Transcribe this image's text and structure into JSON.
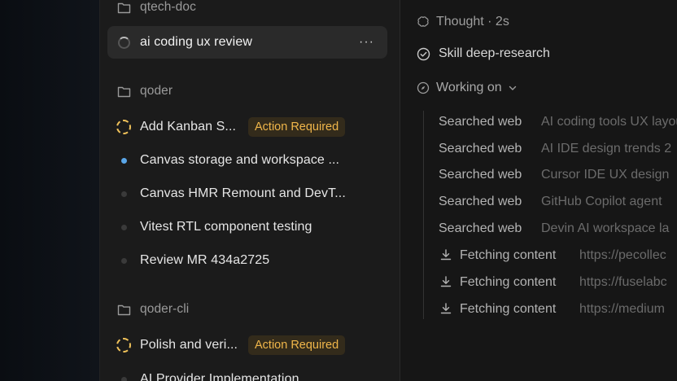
{
  "sidebar": {
    "groups": [
      {
        "name": "qtech-doc"
      },
      {
        "name": "qoder"
      },
      {
        "name": "qoder-cli"
      }
    ],
    "selected": {
      "label": "ai coding ux review",
      "more": "···"
    },
    "items": [
      {
        "label": "Add Kanban S...",
        "badge": "Action Required"
      },
      {
        "label": "Canvas storage and workspace ..."
      },
      {
        "label": "Canvas HMR Remount and DevT..."
      },
      {
        "label": "Vitest RTL component testing"
      },
      {
        "label": "Review MR 434a2725"
      },
      {
        "label": "Polish and veri...",
        "badge": "Action Required"
      },
      {
        "label": "AI Provider Implementation"
      }
    ]
  },
  "main": {
    "thought": "Thought · 2s",
    "skill": "Skill deep-research",
    "working": "Working on",
    "activities": [
      {
        "action": "Searched web",
        "detail": "AI coding tools UX layout"
      },
      {
        "action": "Searched web",
        "detail": "AI IDE design trends 2"
      },
      {
        "action": "Searched web",
        "detail": "Cursor IDE UX design"
      },
      {
        "action": "Searched web",
        "detail": "GitHub Copilot agent"
      },
      {
        "action": "Searched web",
        "detail": "Devin AI workspace la"
      },
      {
        "action": "Fetching content",
        "detail": "https://pecollec"
      },
      {
        "action": "Fetching content",
        "detail": "https://fuselabc"
      },
      {
        "action": "Fetching content",
        "detail": "https://medium"
      }
    ]
  },
  "colors": {
    "badge_text": "#f0b64a",
    "badge_bg": "#332b1b",
    "active_dot": "#5aa6e8"
  }
}
